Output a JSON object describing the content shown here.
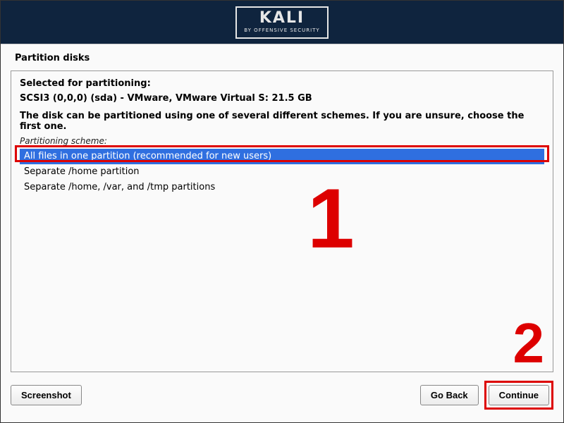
{
  "header": {
    "logo_title": "KALI",
    "logo_subtitle": "BY OFFENSIVE SECURITY"
  },
  "page_title": "Partition disks",
  "panel": {
    "selected_label": "Selected for partitioning:",
    "disk_info": "SCSI3 (0,0,0) (sda) - VMware, VMware Virtual S: 21.5 GB",
    "description": "The disk can be partitioned using one of several different schemes. If you are unsure, choose the first one.",
    "scheme_label": "Partitioning scheme:",
    "options": [
      "All files in one partition (recommended for new users)",
      "Separate /home partition",
      "Separate /home, /var, and /tmp partitions"
    ]
  },
  "annotations": {
    "one": "1",
    "two": "2"
  },
  "buttons": {
    "screenshot": "Screenshot",
    "go_back": "Go Back",
    "continue": "Continue"
  }
}
